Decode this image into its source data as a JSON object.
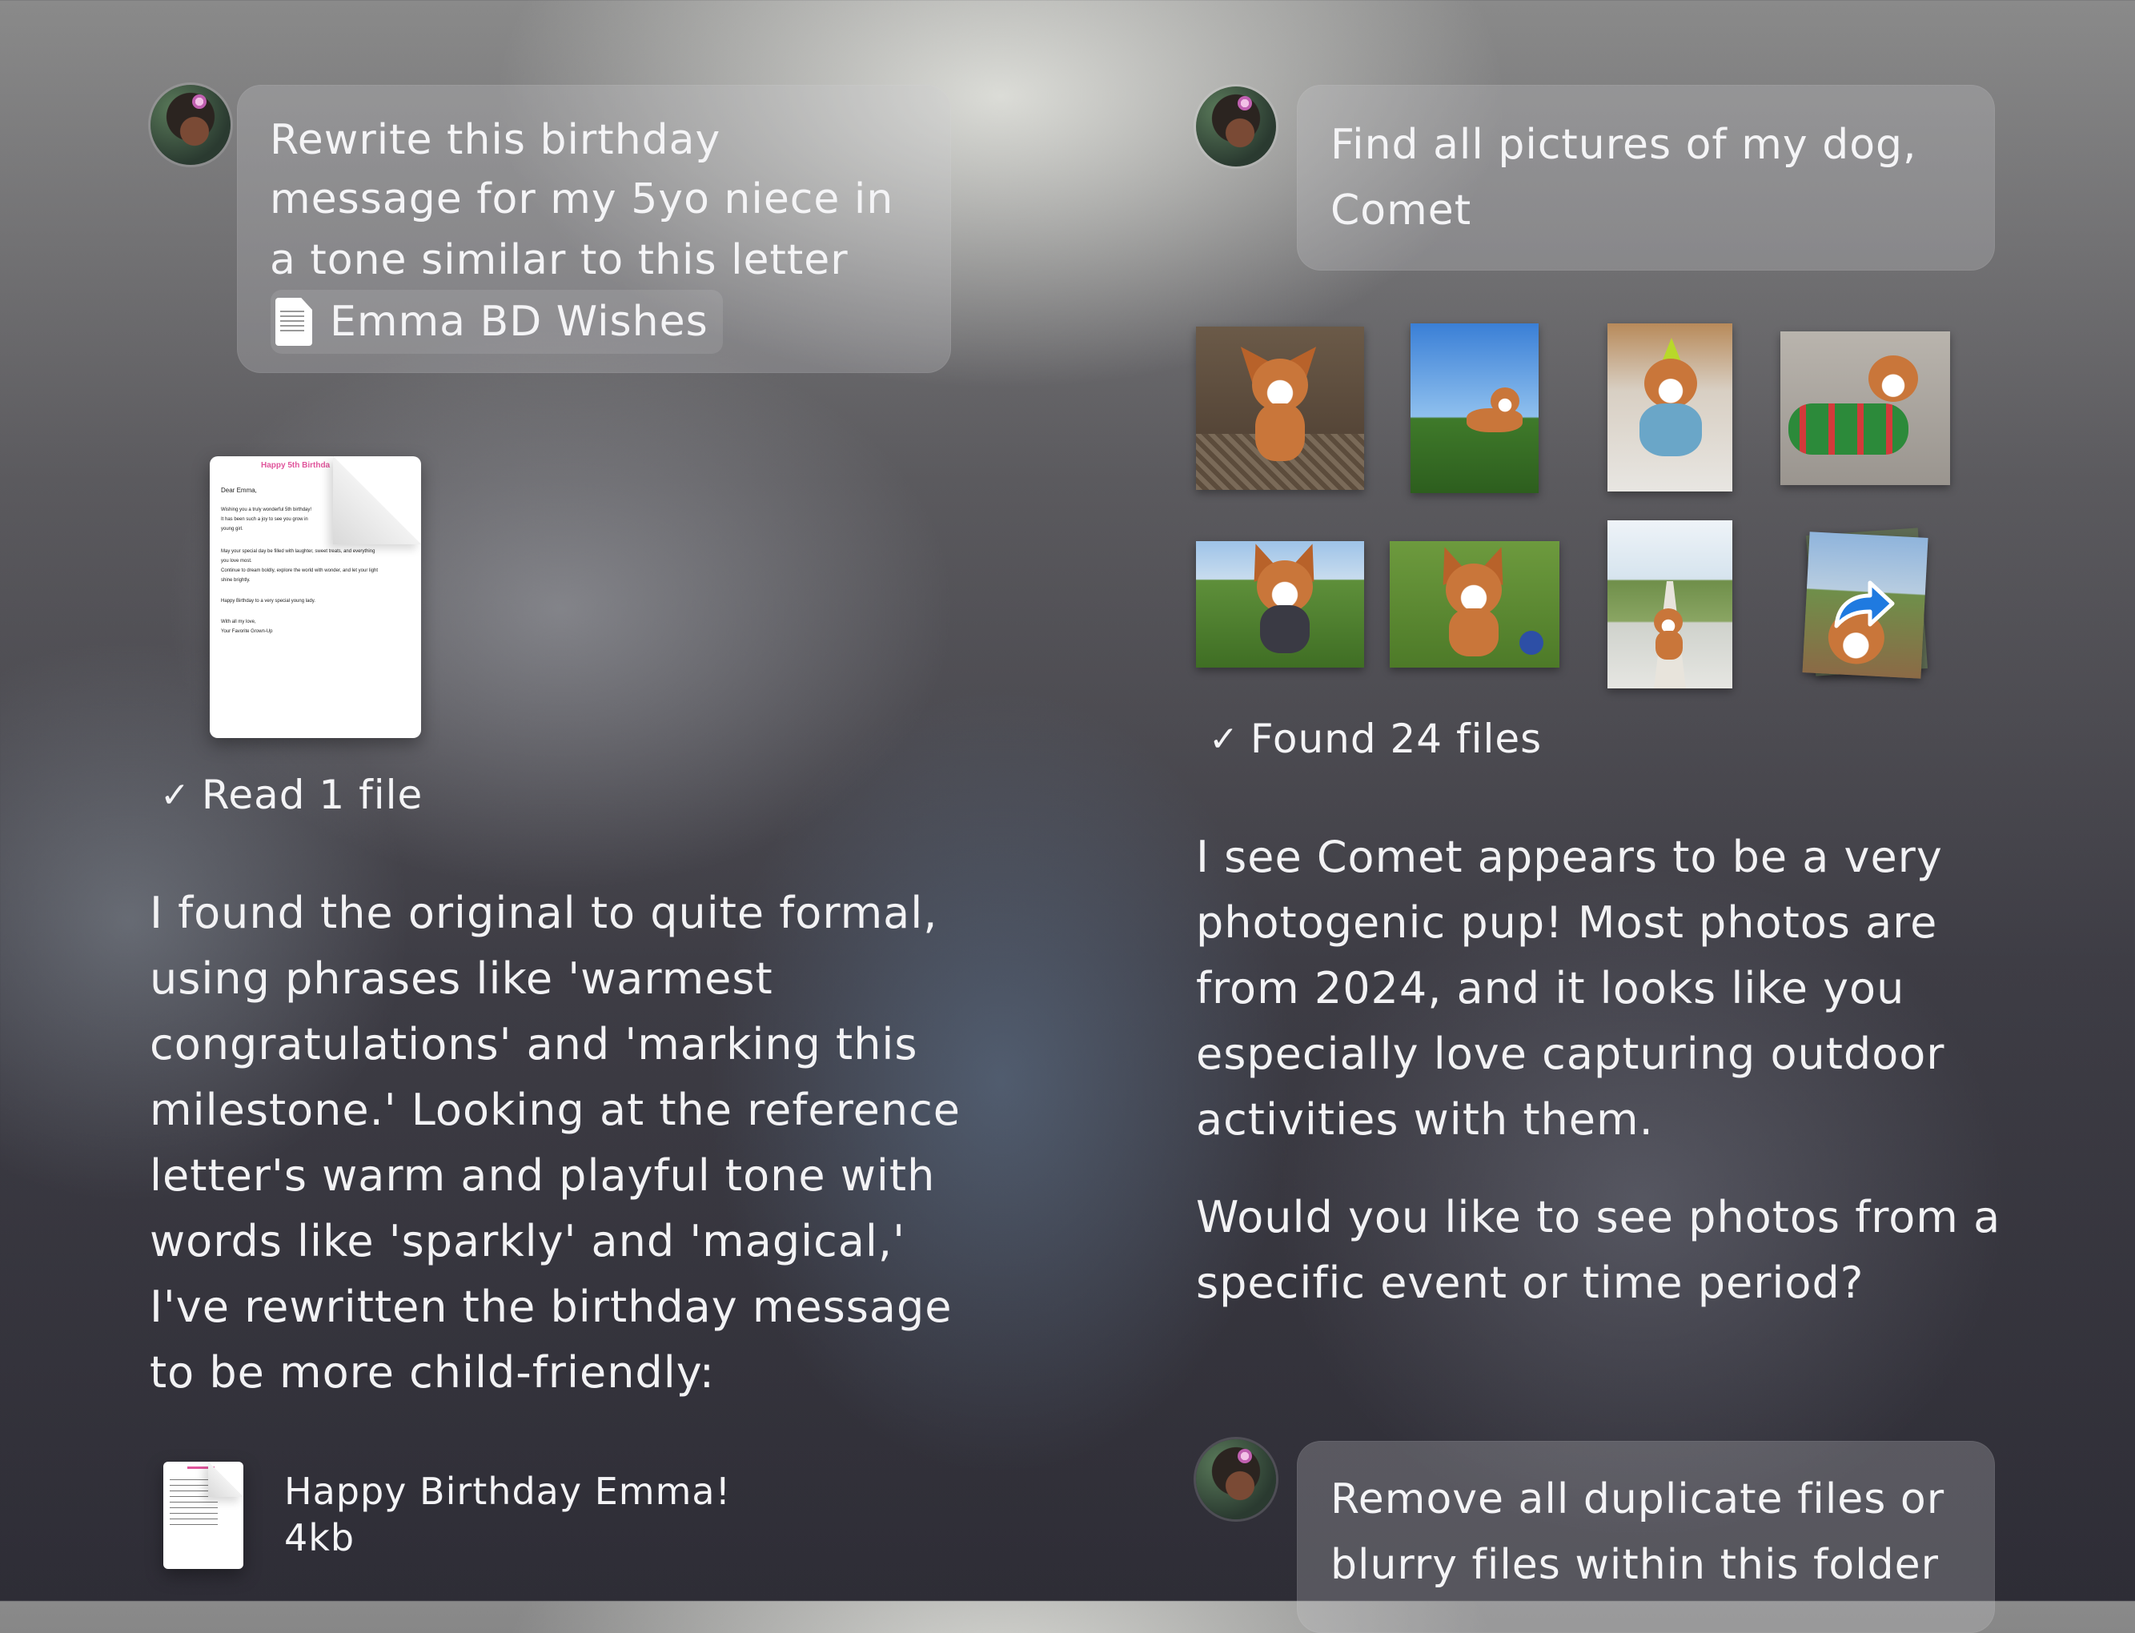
{
  "left": {
    "prompt": {
      "lines": [
        "Rewrite this birthday",
        "message for my 5yo niece in",
        "a tone similar to this letter"
      ],
      "attachment_label": "Emma BD Wishes",
      "attachment_icon": "document-icon"
    },
    "preview_doc": {
      "title": "Happy 5th Birthda",
      "lines": [
        "Dear Emma,",
        "Wishing you a truly wonderful 5th birthday!",
        "It has been such a joy to see you grow in",
        "young girl.",
        "May your special day be filled with laughter, sweet treats, and everything",
        "you love most.",
        "Continue to dream boldly, explore the world with wonder, and let your light",
        "shine brightly.",
        "Happy Birthday to a very special young lady.",
        "With all my love,",
        "Your Favorite Grown-Up"
      ]
    },
    "status": "Read 1 file",
    "response_lines": [
      "I found the original to quite formal,",
      "using phrases like 'warmest",
      "congratulations' and 'marking this",
      "milestone.' Looking at the reference",
      "letter's warm and playful tone with",
      "words like 'sparkly' and 'magical,'",
      "I've rewritten the birthday message",
      "to be more child-friendly:"
    ],
    "result_file": {
      "name": "Happy Birthday Emma!",
      "size": "4kb"
    }
  },
  "right": {
    "prompt": {
      "lines": [
        "Find all pictures of my dog,",
        "Comet"
      ]
    },
    "status": "Found 24 files",
    "response_paragraphs": [
      {
        "lines": [
          "I see Comet appears to be a very",
          "photogenic pup! Most photos are",
          "from 2024, and it looks like you",
          "especially love capturing outdoor",
          "activities with them."
        ]
      },
      {
        "lines": [
          "Would you like to see photos from a",
          "specific event or time period?"
        ]
      }
    ],
    "next_prompt": {
      "lines": [
        "Remove all duplicate files or",
        "blurry files within this folder"
      ]
    }
  },
  "colors": {
    "bubble": "#cdcdd2",
    "text": "#f4f4f6",
    "doc_title": "#e0559c"
  }
}
